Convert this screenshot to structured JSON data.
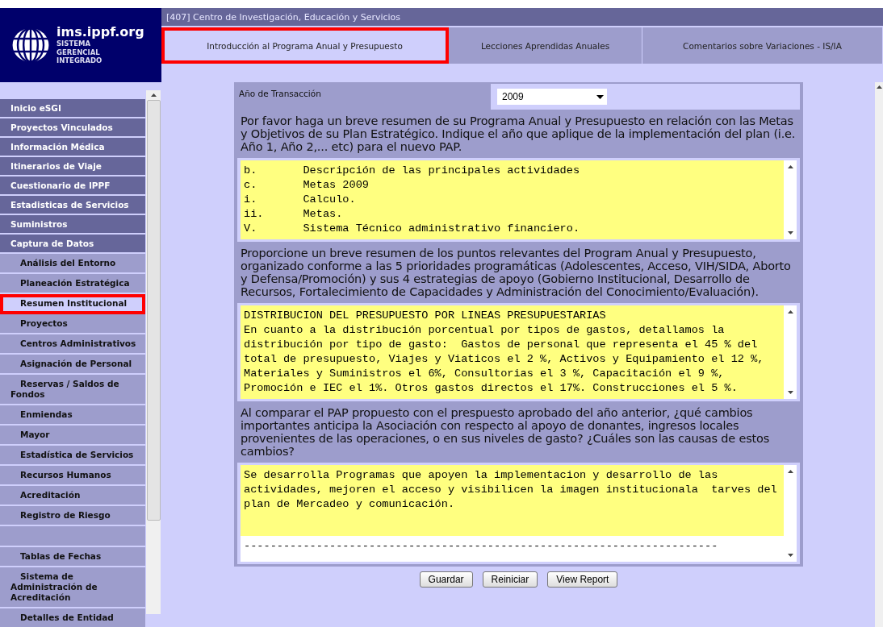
{
  "logo": {
    "domain": "ims.ippf.org",
    "subtitle": [
      "SISTEMA",
      "GERENCIAL",
      "INTEGRADO"
    ]
  },
  "header": {
    "title": "[407] Centro de Investigación, Educación y Servicios"
  },
  "tabs": [
    {
      "label": "Introducción al Programa Anual y Presupuesto",
      "selected": true,
      "highlighted": true
    },
    {
      "label": "Lecciones Aprendidas Anuales",
      "selected": false,
      "highlighted": false
    },
    {
      "label": "Comentarios sobre Variaciones - IS/IA",
      "selected": false,
      "highlighted": false
    }
  ],
  "sidebar": {
    "items": [
      {
        "label": "Inicio eSGI",
        "kind": "section",
        "highlighted": false
      },
      {
        "label": "Proyectos Vinculados",
        "kind": "section",
        "highlighted": false
      },
      {
        "label": "Información Médica",
        "kind": "section",
        "highlighted": false
      },
      {
        "label": "Itinerarios de Viaje",
        "kind": "section",
        "highlighted": false
      },
      {
        "label": "Cuestionario de IPPF",
        "kind": "section",
        "highlighted": false
      },
      {
        "label": "Estadisticas de Servicios",
        "kind": "section",
        "highlighted": false
      },
      {
        "label": "Suministros",
        "kind": "section",
        "highlighted": false
      },
      {
        "label": "Captura de Datos",
        "kind": "section",
        "highlighted": false
      },
      {
        "label": "Análisis del Entorno",
        "kind": "sub",
        "highlighted": false
      },
      {
        "label": "Planeación Estratégica",
        "kind": "sub",
        "highlighted": false
      },
      {
        "label": "Resumen Institucional",
        "kind": "sub",
        "highlighted": true
      },
      {
        "label": "Proyectos",
        "kind": "sub",
        "highlighted": false
      },
      {
        "label": "Centros Administrativos",
        "kind": "sub",
        "highlighted": false
      },
      {
        "label": "Asignación de Personal",
        "kind": "sub",
        "highlighted": false
      },
      {
        "label": "Reservas / Saldos de Fondos",
        "kind": "sub",
        "highlighted": false
      },
      {
        "label": "Enmiendas",
        "kind": "sub",
        "highlighted": false
      },
      {
        "label": "Mayor",
        "kind": "sub",
        "highlighted": false
      },
      {
        "label": "Estadística de Servicios",
        "kind": "sub",
        "highlighted": false
      },
      {
        "label": "Recursos Humanos",
        "kind": "sub",
        "highlighted": false
      },
      {
        "label": "Acreditación",
        "kind": "sub",
        "highlighted": false
      },
      {
        "label": "Registro de Riesgo",
        "kind": "sub",
        "highlighted": false
      },
      {
        "kind": "blank"
      },
      {
        "label": "Tablas de Fechas",
        "kind": "sub",
        "highlighted": false
      },
      {
        "label": "Sistema de Administración de Acreditación",
        "kind": "sub",
        "highlighted": false
      },
      {
        "label": "Detalles de Entidad",
        "kind": "sub",
        "highlighted": false
      },
      {
        "kind": "blank"
      }
    ]
  },
  "form": {
    "year_label": "Año de Transacción",
    "year_value": "2009",
    "sections": [
      {
        "question": "Por favor haga un breve resumen de su Programa Anual y Presupuesto en relación con las Metas y Objetivos de su Plan Estratégico. Indique el año que aplique de la implementación del plan (i.e. Año 1, Año 2,... etc) para el nuevo PAP.",
        "answer": "b.\tDescripción de las principales actividades\nc.\tMetas 2009\ni.\tCalculo.\nii.\tMetas.\nV.\tSistema Técnico administrativo financiero."
      },
      {
        "question": "Proporcione un breve resumen de los puntos relevantes del Program Anual y Presupuesto, organizado conforme a las 5 prioridades programáticas (Adolescentes, Acceso, VIH/SIDA, Aborto y Defensa/Promoción) y sus 4 estrategias de apoyo (Gobierno Institucional, Desarrollo de Recursos, Fortalecimiento de Capacidades y Administración del Conocimiento/Evaluación).",
        "answer": "DISTRIBUCION DEL PRESUPUESTO POR LINEAS PRESUPUESTARIAS\nEn cuanto a la distribución porcentual por tipos de gastos, detallamos la distribución por tipo de gasto:  Gastos de personal que representa el 45 % del total de presupuesto, Viajes y Viaticos el 2 %, Activos y Equipamiento el 12 %, Materiales y Suministros el 6%, Consultorias el 3 %, Capacitación el 9 %, Promoción e IEC el 1%. Otros gastos directos el 17%. Construcciones el 5 %."
      },
      {
        "question": "Al comparar el PAP propuesto con el prespuesto aprobado del año anterior, ¿qué cambios importantes anticipa la Asociación con respecto al apoyo de donantes, ingresos locales provenientes de las operaciones, o en sus niveles de gasto? ¿Cuáles son las causas de estos cambios?",
        "answer": "Se desarrolla Programas que apoyen la implementacion y desarrollo de las actividades, mejoren el acceso y visibilicen la imagen institucionala  tarves del plan de Mercadeo y comunicación.",
        "trailer": "------------------------------------------------------------------------"
      }
    ]
  },
  "buttons": [
    "Guardar",
    "Reiniciar",
    "View Report"
  ]
}
